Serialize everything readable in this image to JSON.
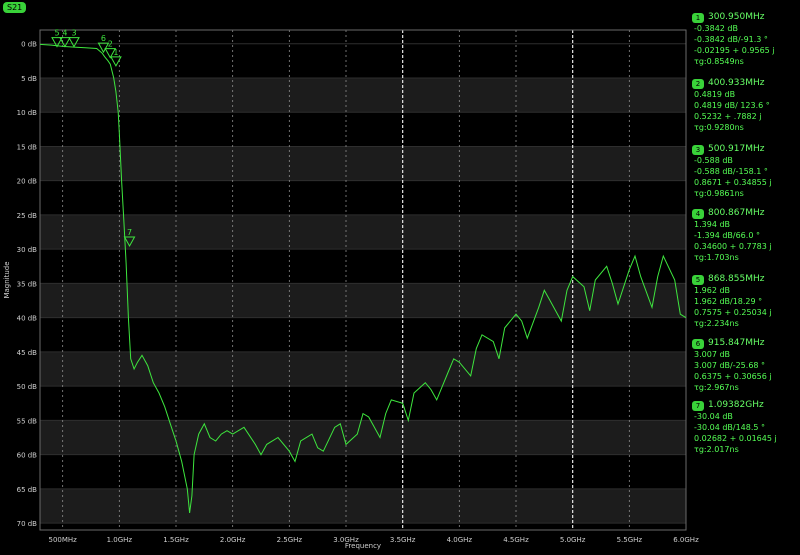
{
  "trace_label": "S21",
  "colors": {
    "background": "#000000",
    "band_dark": "#1c1c1c",
    "trace": "#3ee63e",
    "text": "#cfcfcf",
    "marker_text": "#55ff55"
  },
  "chart_data": {
    "type": "line",
    "xlabel": "Frequency",
    "ylabel": "Magnitude",
    "xlim": [
      0.3,
      6.0
    ],
    "ylim": [
      -71,
      2
    ],
    "x_unit": "GHz",
    "y_unit": "dB",
    "x_ticks": [
      {
        "v": 0.5,
        "label": "500MHz"
      },
      {
        "v": 1.0,
        "label": "1.0GHz"
      },
      {
        "v": 1.5,
        "label": "1.5GHz"
      },
      {
        "v": 2.0,
        "label": "2.0GHz"
      },
      {
        "v": 2.5,
        "label": "2.5GHz"
      },
      {
        "v": 3.0,
        "label": "3.0GHz"
      },
      {
        "v": 3.5,
        "label": "3.5GHz"
      },
      {
        "v": 4.0,
        "label": "4.0GHz"
      },
      {
        "v": 4.5,
        "label": "4.5GHz"
      },
      {
        "v": 5.0,
        "label": "5.0GHz"
      },
      {
        "v": 5.5,
        "label": "5.5GHz"
      },
      {
        "v": 6.0,
        "label": "6.0GHz"
      }
    ],
    "y_ticks": [
      0,
      -5,
      -10,
      -15,
      -20,
      -25,
      -30,
      -35,
      -40,
      -45,
      -50,
      -55,
      -60,
      -65,
      -70
    ],
    "y_tick_labels": [
      "0 dB",
      "5 dB",
      "10 dB",
      "15 dB",
      "20 dB",
      "25 dB",
      "30 dB",
      "35 dB",
      "40 dB",
      "45 dB",
      "50 dB",
      "55 dB",
      "60 dB",
      "65 dB",
      "70 dB"
    ],
    "series": [
      {
        "x": [
          0.3,
          0.4,
          0.5,
          0.6,
          0.7,
          0.8,
          0.85,
          0.87,
          0.9,
          0.92,
          0.95,
          0.97,
          0.99,
          1.0,
          1.02,
          1.04,
          1.06,
          1.08,
          1.1,
          1.13,
          1.16,
          1.2,
          1.25,
          1.3,
          1.35,
          1.4,
          1.45,
          1.5,
          1.55,
          1.6,
          1.62,
          1.64,
          1.66,
          1.7,
          1.75,
          1.8,
          1.85,
          1.9,
          1.95,
          2.0,
          2.1,
          2.2,
          2.25,
          2.3,
          2.4,
          2.5,
          2.55,
          2.6,
          2.7,
          2.75,
          2.8,
          2.9,
          2.95,
          3.0,
          3.1,
          3.15,
          3.2,
          3.3,
          3.35,
          3.4,
          3.5,
          3.55,
          3.6,
          3.7,
          3.75,
          3.8,
          3.9,
          3.95,
          4.0,
          4.1,
          4.15,
          4.2,
          4.3,
          4.35,
          4.4,
          4.5,
          4.55,
          4.6,
          4.7,
          4.75,
          4.8,
          4.9,
          4.95,
          5.0,
          5.1,
          5.15,
          5.2,
          5.3,
          5.35,
          5.4,
          5.5,
          5.55,
          5.6,
          5.7,
          5.75,
          5.8,
          5.9,
          5.95,
          6.0
        ],
        "y": [
          -0.1,
          -0.2,
          -0.4,
          -0.5,
          -0.6,
          -0.7,
          -1.4,
          -1.9,
          -2.5,
          -3.0,
          -5.0,
          -7.0,
          -10.0,
          -13.0,
          -20.0,
          -26.0,
          -32.0,
          -40.0,
          -46.0,
          -47.5,
          -46.5,
          -45.5,
          -47.0,
          -49.5,
          -51.0,
          -53.0,
          -55.5,
          -58.0,
          -61.0,
          -65.0,
          -68.5,
          -66.0,
          -60.0,
          -57.0,
          -55.5,
          -57.5,
          -58.0,
          -57.0,
          -56.5,
          -57.0,
          -56.0,
          -58.5,
          -60.0,
          -58.5,
          -57.5,
          -59.5,
          -61.0,
          -58.0,
          -57.0,
          -59.0,
          -59.5,
          -56.0,
          -55.5,
          -58.5,
          -57.0,
          -54.0,
          -54.5,
          -57.5,
          -54.0,
          -52.0,
          -52.5,
          -55.0,
          -51.0,
          -49.5,
          -50.5,
          -52.0,
          -48.0,
          -46.0,
          -46.5,
          -48.5,
          -44.5,
          -42.5,
          -43.5,
          -46.0,
          -41.5,
          -39.5,
          -40.5,
          -43.0,
          -38.5,
          -36.0,
          -37.5,
          -40.5,
          -36.0,
          -34.0,
          -35.5,
          -39.0,
          -34.5,
          -32.5,
          -35.0,
          -38.0,
          -33.0,
          -31.0,
          -34.0,
          -38.5,
          -34.0,
          -31.0,
          -34.5,
          -39.5,
          -40.0
        ]
      }
    ],
    "markers": [
      {
        "n": "1",
        "x": 0.30095,
        "freq": "300.950MHz",
        "lines": [
          "-0.3842 dB",
          "-0.3842 dB/-91.3 °",
          "-0.02195 + 0.9565 j",
          "τg:0.8549ns"
        ]
      },
      {
        "n": "2",
        "x": 0.400933,
        "freq": "400.933MHz",
        "lines": [
          "0.4819 dB",
          "0.4819 dB/ 123.6 °",
          "0.5232 + .7882 j",
          "τg:0.9280ns"
        ]
      },
      {
        "n": "3",
        "x": 0.500917,
        "freq": "500.917MHz",
        "lines": [
          "-0.588 dB",
          "-0.588 dB/-158.1 °",
          "0.8671 + 0.34855 j",
          "τg:0.9861ns"
        ]
      },
      {
        "n": "4",
        "x": 0.800867,
        "freq": "800.867MHz",
        "lines": [
          "1.394 dB",
          "-1.394 dB/66.0 °",
          "0.34600 + 0.7783 j",
          "τg:1.703ns"
        ]
      },
      {
        "n": "5",
        "x": 0.868855,
        "freq": "868.855MHz",
        "lines": [
          "1.962 dB",
          "1.962 dB/18.29 °",
          "0.7575 + 0.25034 j",
          "τg:2.234ns"
        ]
      },
      {
        "n": "6",
        "x": 0.915847,
        "freq": "915.847MHz",
        "lines": [
          "3.007 dB",
          "3.007 dB/-25.68 °",
          "0.6375 + 0.30656 j",
          "τg:2.967ns"
        ]
      },
      {
        "n": "7",
        "x": 1.09382,
        "freq": "1.09382GHz",
        "lines": [
          "-30.04 dB",
          "-30.04 dB/148.5 °",
          "0.02682 + 0.01645 j",
          "τg:2.017ns"
        ]
      }
    ],
    "plot_markers": [
      {
        "label": "5",
        "x": 0.45,
        "y": 0.3
      },
      {
        "label": "4",
        "x": 0.52,
        "y": 0.3
      },
      {
        "label": "3",
        "x": 0.6,
        "y": 0.3
      },
      {
        "label": "6",
        "x": 0.86,
        "y": -0.5
      },
      {
        "label": "2",
        "x": 0.92,
        "y": -1.3
      },
      {
        "label": "1",
        "x": 0.97,
        "y": -2.5
      },
      {
        "label": "7",
        "x": 1.09,
        "y": -28.8
      }
    ],
    "grid": true,
    "legend": "right"
  }
}
